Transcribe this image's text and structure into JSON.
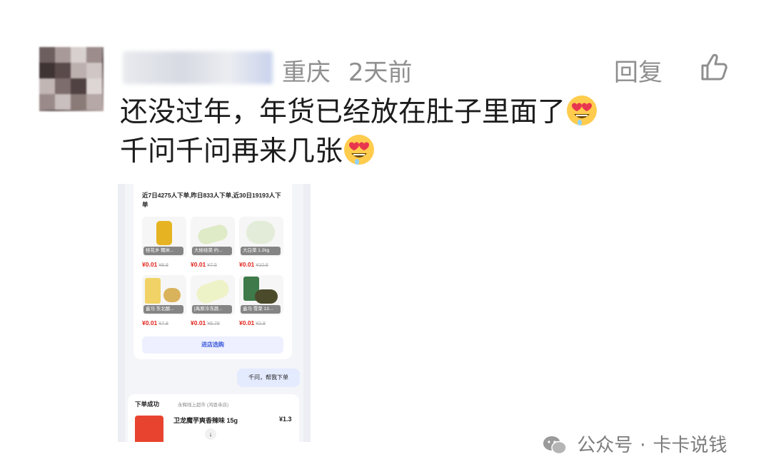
{
  "comment": {
    "location": "重庆",
    "time_ago": "2天前",
    "reply_label": "回复",
    "line1": "还没过年，年货已经放在肚子里面了",
    "line2": "千问千问再来几张",
    "emoji": "heart-eyes-emoji",
    "icons": {
      "like": "thumbs-up-icon"
    }
  },
  "screenshot": {
    "header_text": "近7日4275人下单,昨日833人下单,近30日19193人下单",
    "products": [
      {
        "label": "桂花乡 糯米...",
        "price": "¥0.01",
        "orig_price": "¥8.8"
      },
      {
        "label": "大娃娃菜 约...",
        "price": "¥0.01",
        "orig_price": "¥7.5"
      },
      {
        "label": "大白菜 1.2kg",
        "price": "¥0.01",
        "orig_price": "¥10.8"
      },
      {
        "label": "盒马 东北酸...",
        "price": "¥0.01",
        "orig_price": "¥7.8"
      },
      {
        "label": "[禹原冷冻蔬...",
        "price": "¥0.01",
        "orig_price": "¥6.78"
      },
      {
        "label": "盒马 雪菜 13...",
        "price": "¥0.01",
        "orig_price": "¥2.8"
      }
    ],
    "shop_button": "进店选购",
    "user_bubble": "千问，帮我下单",
    "order": {
      "status": "下单成功",
      "store": "永辉线上超市 (鸿恩寺店)",
      "product_name": "卫龙魔芋爽香辣味 15g",
      "product_price": "¥1.3"
    }
  },
  "watermark": {
    "label": "公众号",
    "separator": "·",
    "account": "卡卡说钱"
  }
}
